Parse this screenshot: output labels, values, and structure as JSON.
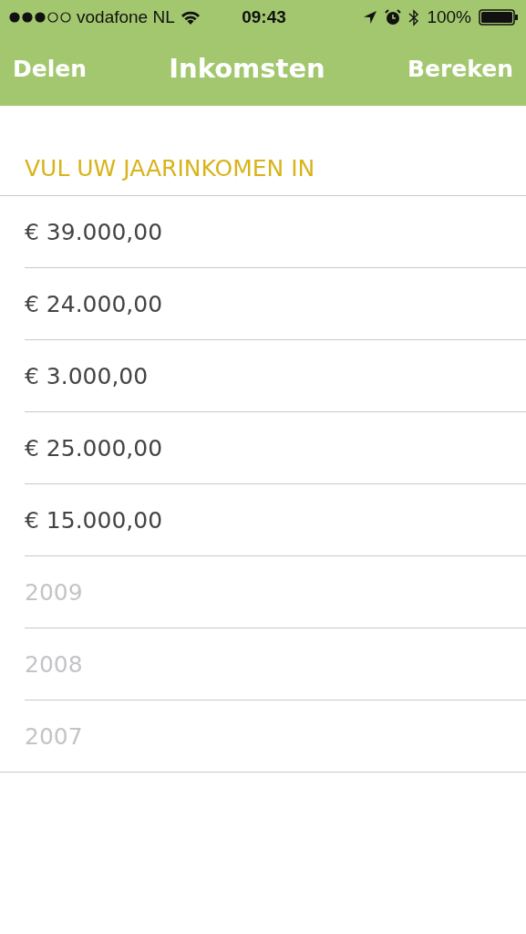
{
  "status_bar": {
    "carrier": "vodafone NL",
    "time": "09:43",
    "battery": "100%"
  },
  "nav_bar": {
    "left_button": "Delen",
    "title": "Inkomsten",
    "right_button": "Bereken"
  },
  "section": {
    "heading": "VUL UW JAARINKOMEN IN"
  },
  "fields": [
    {
      "value": "€ 39.000,00"
    },
    {
      "value": "€ 24.000,00"
    },
    {
      "value": "€ 3.000,00"
    },
    {
      "value": "€ 25.000,00"
    },
    {
      "value": "€ 15.000,00"
    },
    {
      "placeholder": "2009"
    },
    {
      "placeholder": "2008"
    },
    {
      "placeholder": "2007"
    }
  ]
}
